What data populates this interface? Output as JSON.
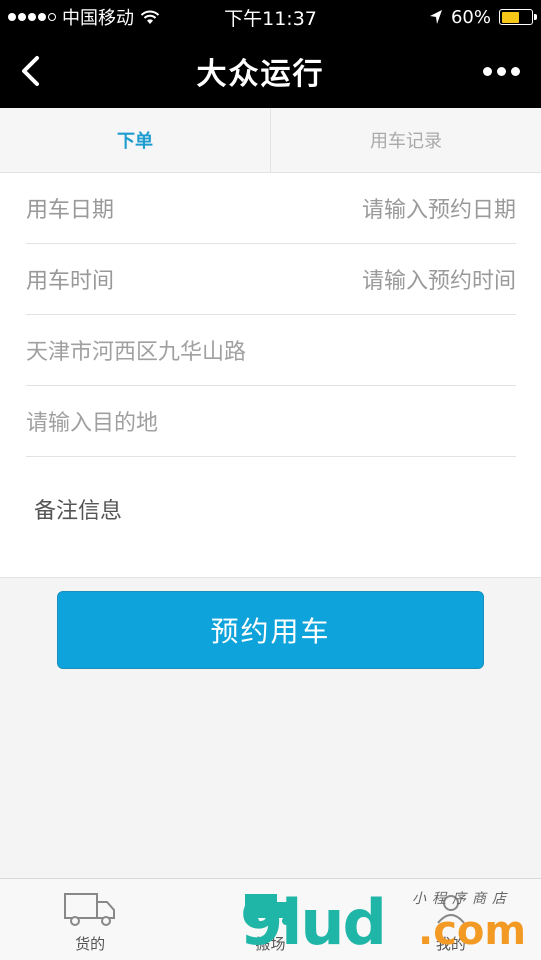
{
  "status_bar": {
    "carrier": "中国移动",
    "time": "下午11:37",
    "battery_pct": "60%",
    "battery_level": 0.6
  },
  "nav": {
    "title": "大众运行"
  },
  "tabs": [
    {
      "label": "下单",
      "active": true
    },
    {
      "label": "用车记录",
      "active": false
    }
  ],
  "form": {
    "date": {
      "label": "用车日期",
      "placeholder": "请输入预约日期"
    },
    "time": {
      "label": "用车时间",
      "placeholder": "请输入预约时间"
    },
    "origin": "天津市河西区九华山路",
    "destination": "请输入目的地",
    "remark": "备注信息"
  },
  "submit_label": "预约用车",
  "tabbar": [
    {
      "label": "货的",
      "icon": "truck-icon"
    },
    {
      "label": "搬场",
      "icon": "moving-truck-icon"
    },
    {
      "label": "我的",
      "icon": "user-icon"
    }
  ],
  "watermark": {
    "brand": "9lud",
    "suffix": ".com",
    "small_text": "小程序商店"
  },
  "colors": {
    "accent": "#1e9cd0",
    "button": "#0ea3db",
    "nav_bg": "#000000",
    "battery": "#f5c518"
  }
}
